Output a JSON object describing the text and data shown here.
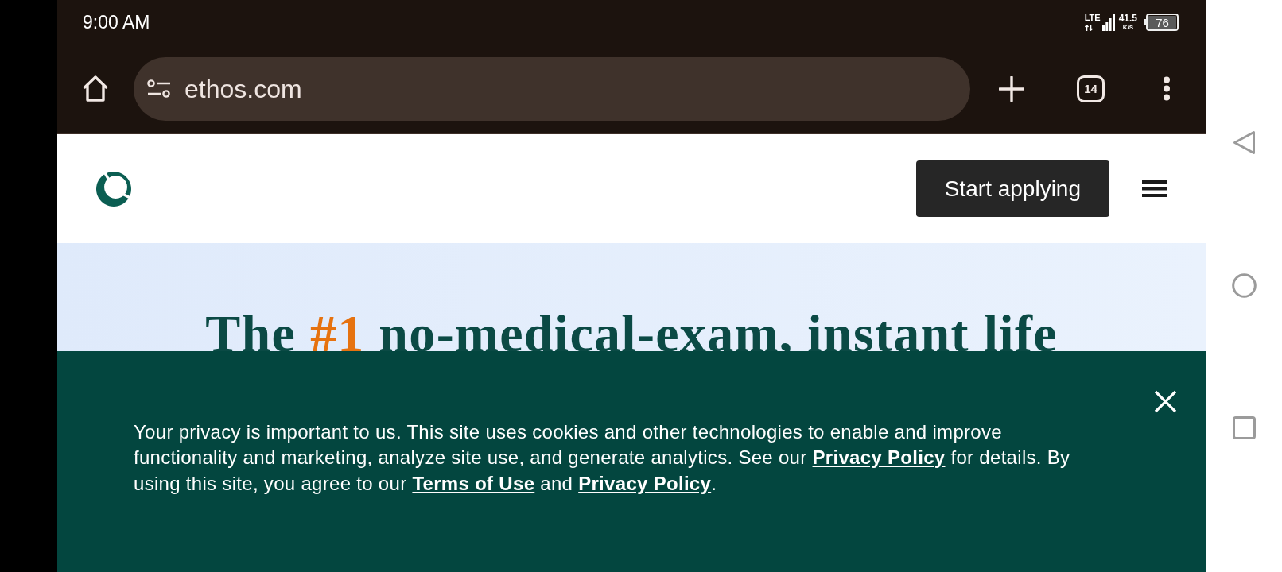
{
  "status_bar": {
    "time": "9:00 AM",
    "network": "LTE",
    "speed": "41.5",
    "speed_unit": "K/S",
    "battery": "76"
  },
  "browser_toolbar": {
    "url": "ethos.com",
    "tab_count": "14"
  },
  "site_header": {
    "cta_button": "Start applying"
  },
  "hero": {
    "headline": [
      {
        "text": "The ",
        "highlight": false
      },
      {
        "text": "#1",
        "highlight": true
      },
      {
        "text": " no-medical-exam, instant life",
        "highlight": false
      }
    ]
  },
  "cookie_banner": {
    "message": [
      {
        "kind": "text",
        "text": "Your privacy is important to us. This site uses cookies and other technologies to enable and improve functionality and marketing, analyze site use, and generate analytics. See our "
      },
      {
        "kind": "link",
        "text": "Privacy Policy"
      },
      {
        "kind": "text",
        "text": " for details. By using this site, you agree to our "
      },
      {
        "kind": "link",
        "text": "Terms of Use"
      },
      {
        "kind": "text",
        "text": " and "
      },
      {
        "kind": "link",
        "text": "Privacy Policy"
      },
      {
        "kind": "text",
        "text": "."
      }
    ]
  }
}
